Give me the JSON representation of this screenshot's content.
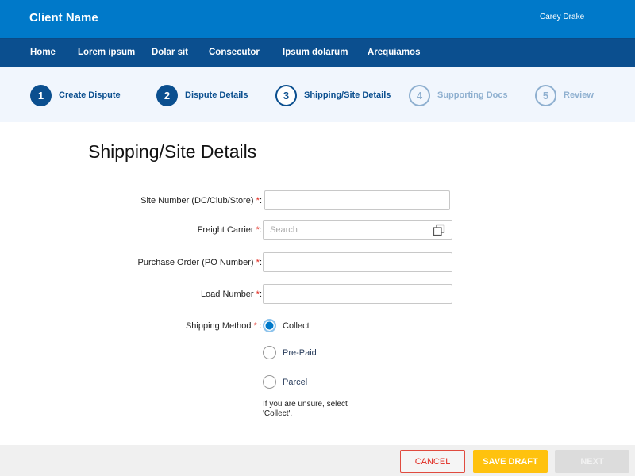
{
  "header": {
    "client_name": "Client Name",
    "user_name": "Carey Drake"
  },
  "nav": {
    "items": [
      {
        "label": "Home"
      },
      {
        "label": "Lorem ipsum"
      },
      {
        "label": "Dolar sit"
      },
      {
        "label": "Consecutor"
      },
      {
        "label": "Ipsum dolarum"
      },
      {
        "label": "Arequiamos"
      }
    ]
  },
  "stepper": {
    "steps": [
      {
        "number": "1",
        "label": "Create Dispute",
        "state": "done"
      },
      {
        "number": "2",
        "label": "Dispute Details",
        "state": "done"
      },
      {
        "number": "3",
        "label": "Shipping/Site Details",
        "state": "current"
      },
      {
        "number": "4",
        "label": "Supporting Docs",
        "state": "future"
      },
      {
        "number": "5",
        "label": "Review",
        "state": "future"
      }
    ]
  },
  "form": {
    "title": "Shipping/Site Details",
    "required_marker": "*",
    "fields": {
      "site_number": {
        "label": "Site Number (DC/Club/Store) ",
        "suffix": ":",
        "value": ""
      },
      "freight_carrier": {
        "label": "Freight Carrier ",
        "suffix": ":",
        "value": "",
        "placeholder": "Search",
        "icon": "lookup-icon"
      },
      "purchase_order": {
        "label": "Purchase Order (PO Number) ",
        "suffix": ":",
        "value": ""
      },
      "load_number": {
        "label": "Load Number ",
        "suffix": ":",
        "value": ""
      }
    },
    "shipping_method": {
      "label": "Shipping Method ",
      "suffix": " :",
      "selected": "Collect",
      "options": [
        {
          "label": "Collect",
          "checked": true
        },
        {
          "label": "Pre-Paid",
          "checked": false
        },
        {
          "label": "Parcel",
          "checked": false
        }
      ],
      "hint": "If you are unsure, select 'Collect'."
    }
  },
  "footer": {
    "cancel_label": "CANCEL",
    "save_draft_label": "SAVE DRAFT",
    "next_label": "NEXT",
    "colors": {
      "cancel": "#e0281e",
      "save_draft": "#ffc20e",
      "next_disabled": "#dcdcdc"
    }
  },
  "colors": {
    "header_bg": "#0079c9",
    "nav_bg": "#0b4f8f",
    "stepper_bg": "#f1f6fd",
    "step_active": "#0b4f8f",
    "step_inactive": "#8fb0d0"
  }
}
